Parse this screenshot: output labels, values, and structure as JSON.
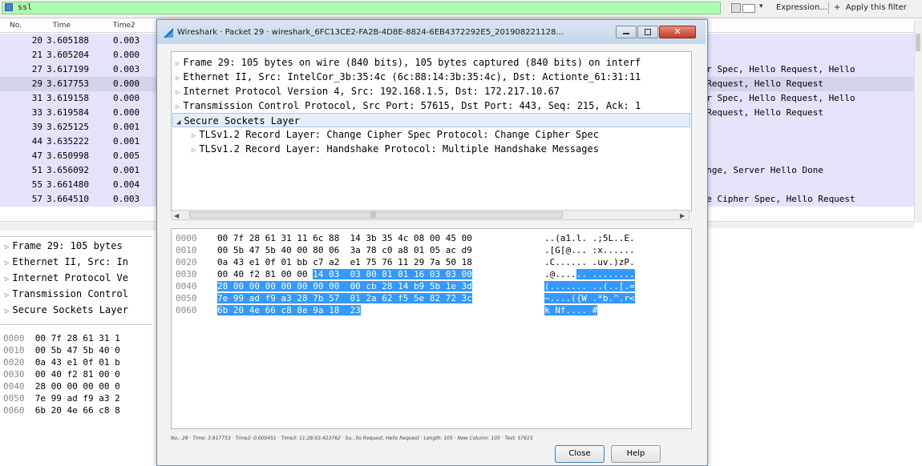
{
  "filter": {
    "value": "ssl",
    "bookmark_icon": "bookmark-icon",
    "expression_label": "Expression...",
    "apply_label": "Apply this filter",
    "dropdown_glyph": "▾",
    "add_glyph": "+"
  },
  "packet_list": {
    "columns": [
      "No.",
      "Time",
      "Time2"
    ],
    "rows": [
      {
        "no": "20",
        "time": "3.605188",
        "time2": "0.003",
        "info": ""
      },
      {
        "no": "21",
        "time": "3.605204",
        "time2": "0.000",
        "info": ""
      },
      {
        "no": "27",
        "time": "3.617199",
        "time2": "0.003",
        "info": "her Spec, Hello Request, Hello"
      },
      {
        "no": "29",
        "time": "3.617753",
        "time2": "0.000",
        "info": ", Request, Hello Request",
        "selected": true
      },
      {
        "no": "31",
        "time": "3.619158",
        "time2": "0.000",
        "info": "her Spec, Hello Request, Hello"
      },
      {
        "no": "33",
        "time": "3.619584",
        "time2": "0.000",
        "info": ", Request, Hello Request"
      },
      {
        "no": "39",
        "time": "3.625125",
        "time2": "0.001",
        "info": ""
      },
      {
        "no": "44",
        "time": "3.635222",
        "time2": "0.001",
        "info": ""
      },
      {
        "no": "47",
        "time": "3.650998",
        "time2": "0.005",
        "info": ""
      },
      {
        "no": "51",
        "time": "3.656092",
        "time2": "0.001",
        "info": "hange, Server Hello Done"
      },
      {
        "no": "55",
        "time": "3.661480",
        "time2": "0.004",
        "info": ""
      },
      {
        "no": "57",
        "time": "3.664510",
        "time2": "0.003",
        "info": "nge Cipher Spec, Hello Request"
      }
    ]
  },
  "details": [
    "Frame 29: 105 bytes",
    "Ethernet II, Src: In",
    "Internet Protocol Ve",
    "Transmission Control",
    "Secure Sockets Layer"
  ],
  "bytes": [
    {
      "off": "0000",
      "hex": "00 7f 28 61 31 1"
    },
    {
      "off": "0010",
      "hex": "00 5b 47 5b 40 0"
    },
    {
      "off": "0020",
      "hex": "0a 43 e1 0f 01 b"
    },
    {
      "off": "0030",
      "hex": "00 40 f2 81 00 0"
    },
    {
      "off": "0040",
      "hex": "28 00 00 00 00 0"
    },
    {
      "off": "0050",
      "hex": "7e 99 ad f9 a3 2"
    },
    {
      "off": "0060",
      "hex": "6b 20 4e 66 c8 8"
    }
  ],
  "dialog": {
    "title": "Wireshark · Packet 29 · wireshark_6FC13CE2-FA2B-4D8E-8824-6EB4372292E5_201908221128...",
    "tree": [
      {
        "text": "Frame 29: 105 bytes on wire (840 bits), 105 bytes captured (840 bits) on interf",
        "level": 0,
        "expanded": false
      },
      {
        "text": "Ethernet II, Src: IntelCor_3b:35:4c (6c:88:14:3b:35:4c), Dst: Actionte_61:31:11",
        "level": 0,
        "expanded": false
      },
      {
        "text": "Internet Protocol Version 4, Src: 192.168.1.5, Dst: 172.217.10.67",
        "level": 0,
        "expanded": false
      },
      {
        "text": "Transmission Control Protocol, Src Port: 57615, Dst Port: 443, Seq: 215, Ack: 1",
        "level": 0,
        "expanded": false
      },
      {
        "text": "Secure Sockets Layer",
        "level": 0,
        "expanded": true,
        "selected": true
      },
      {
        "text": "TLSv1.2 Record Layer: Change Cipher Spec Protocol: Change Cipher Spec",
        "level": 1,
        "expanded": false
      },
      {
        "text": "TLSv1.2 Record Layer: Handshake Protocol: Multiple Handshake Messages",
        "level": 1,
        "expanded": false
      }
    ],
    "hex_rows": [
      {
        "off": "0000",
        "hex_plain": "00 7f 28 61 31 11 6c 88  14 3b 35 4c 08 00 45 00",
        "hex_hl": "",
        "ascii_plain": "..(a1.l. .;5L..E.",
        "ascii_hl": ""
      },
      {
        "off": "0010",
        "hex_plain": "00 5b 47 5b 40 00 80 06  3a 78 c0 a8 01 05 ac d9",
        "hex_hl": "",
        "ascii_plain": ".[G[@... :x......",
        "ascii_hl": ""
      },
      {
        "off": "0020",
        "hex_plain": "0a 43 e1 0f 01 bb c7 a2  e1 75 76 11 29 7a 50 18",
        "hex_hl": "",
        "ascii_plain": ".C...... .uv.)zP.",
        "ascii_hl": ""
      },
      {
        "off": "0030",
        "hex_plain": "00 40 f2 81 00 00 ",
        "hex_hl": "14 03  03 00 01 01 16 03 03 00",
        "ascii_plain": ".@....",
        "ascii_hl": ".. ........"
      },
      {
        "off": "0040",
        "hex_plain": "",
        "hex_hl": "28 00 00 00 00 00 00 00  00 cb 28 14 b9 5b 1e 3d",
        "ascii_plain": "",
        "ascii_hl": "(....... ..(..[.="
      },
      {
        "off": "0050",
        "hex_plain": "",
        "hex_hl": "7e 99 ad f9 a3 28 7b 57  01 2a 62 f5 5e 82 72 3c",
        "ascii_plain": "",
        "ascii_hl": "~....({W .*b.^.r<"
      },
      {
        "off": "0060",
        "hex_plain": "",
        "hex_hl": "6b 20 4e 66 c8 8e 9a 18  23",
        "ascii_plain": "",
        "ascii_hl": "k Nf.... #"
      }
    ],
    "status": "No.: 29 · Time: 3.617753 · Time2: 0.000451 · Time3: 11:28:03.423762 · So...llo Request, Hello Request · Length: 105 · New Column: 105 · Test: 57615",
    "close_label": "Close",
    "help_label": "Help",
    "win_close_glyph": "✕"
  },
  "colors": {
    "filter_valid": "#afffaf",
    "row_bg": "#e4e3fb",
    "hex_highlight": "#3399ff",
    "title_gradient": "#c4d6ec"
  }
}
